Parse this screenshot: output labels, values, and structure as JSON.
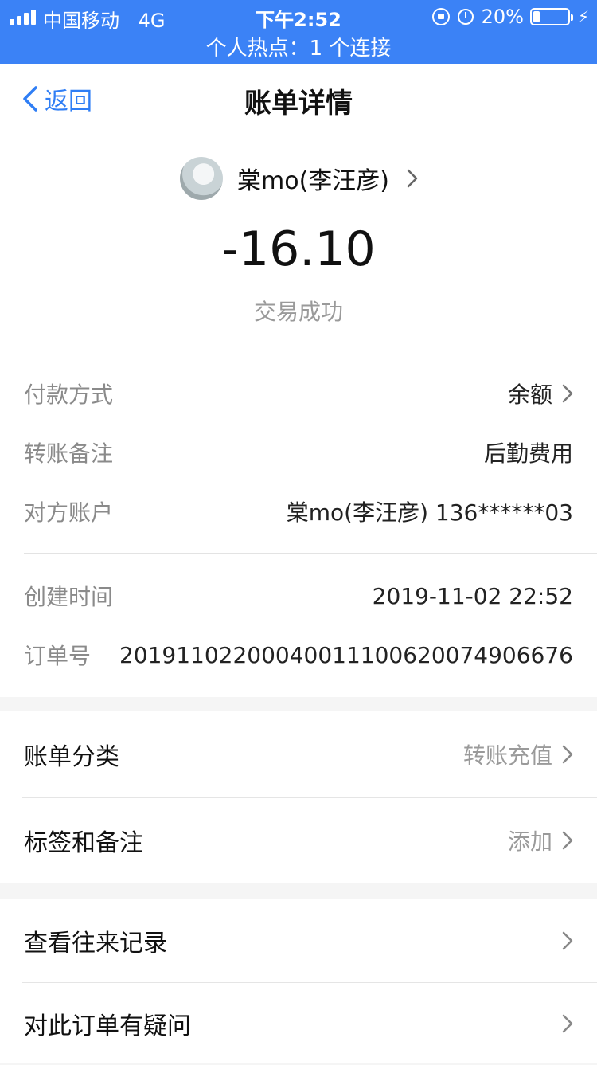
{
  "status_bar": {
    "carrier": "中国移动",
    "network": "4G",
    "time": "下午2:52",
    "battery_percent_text": "20%",
    "battery_level": 0.2,
    "hotspot": "个人热点：1 个连接"
  },
  "nav": {
    "back_label": "返回",
    "title": "账单详情"
  },
  "summary": {
    "payee_name": "棠mo(李汪彦)",
    "amount": "-16.10",
    "status": "交易成功"
  },
  "details": [
    {
      "label": "付款方式",
      "value": "余额"
    },
    {
      "label": "转账备注",
      "value": "后勤费用"
    },
    {
      "label": "对方账户",
      "value": "棠mo(李汪彦) 136******03"
    },
    {
      "label": "创建时间",
      "value": "2019-11-02 22:52"
    },
    {
      "label": "订单号",
      "value": "20191102200040011100620074906676"
    }
  ],
  "menu1": [
    {
      "label": "账单分类",
      "value": "转账充值"
    },
    {
      "label": "标签和备注",
      "value": "添加"
    }
  ],
  "menu2": [
    {
      "label": "查看往来记录"
    },
    {
      "label": "对此订单有疑问"
    }
  ],
  "colors": {
    "status_bar_bg": "#3b82f6",
    "accent_blue": "#2f7ef5",
    "muted_text": "#9a9a9a"
  }
}
